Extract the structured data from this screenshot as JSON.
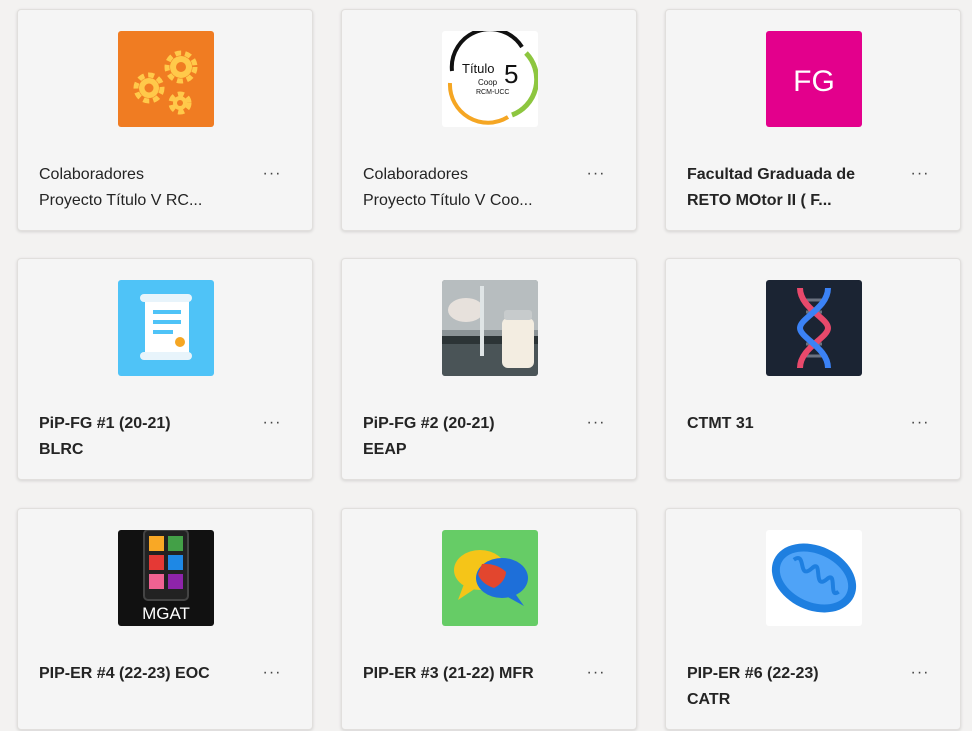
{
  "teams": [
    {
      "line1": "Colaboradores",
      "line2": "Proyecto Título V RC...",
      "more_label": "···",
      "icon": "gears-icon",
      "tile_color": "#f07c22"
    },
    {
      "line1": "Colaboradores",
      "line2": "Proyecto Título V Coo...",
      "more_label": "···",
      "icon": "titulo-5-coop-logo",
      "tile_color": "#ffffff",
      "logo_text": {
        "word": "Título",
        "number": "5",
        "sub1": "Coop",
        "sub2": "RCM-UCC"
      }
    },
    {
      "line1": "Facultad Graduada de",
      "line2": "RETO MOtor II ( F...",
      "more_label": "···",
      "icon": "fg-initials-icon",
      "tile_color": "#e3008c",
      "initials": "FG"
    },
    {
      "line1": "PiP-FG #1 (20-21)",
      "line2": "BLRC",
      "more_label": "···",
      "icon": "scroll-document-icon",
      "tile_color": "#4fc3f7"
    },
    {
      "line1": "PiP-FG #2 (20-21)",
      "line2": "EEAP",
      "more_label": "···",
      "icon": "lab-photo-icon",
      "tile_color": "#6f7a7d"
    },
    {
      "line1": "CTMT 31",
      "line2": "",
      "more_label": "···",
      "icon": "dna-icon",
      "tile_color": "#1b2433"
    },
    {
      "line1": "PIP-ER #4 (22-23) EOC",
      "line2": "",
      "more_label": "···",
      "icon": "mgat-app-icon",
      "tile_color": "#111111",
      "caption": "MGAT"
    },
    {
      "line1": "PIP-ER #3 (21-22) MFR",
      "line2": "",
      "more_label": "···",
      "icon": "chat-bubbles-icon",
      "tile_color": "#66cc66"
    },
    {
      "line1": "PIP-ER #6 (22-23)",
      "line2": "CATR",
      "more_label": "···",
      "icon": "mitochondria-icon",
      "tile_color": "#ffffff"
    }
  ]
}
